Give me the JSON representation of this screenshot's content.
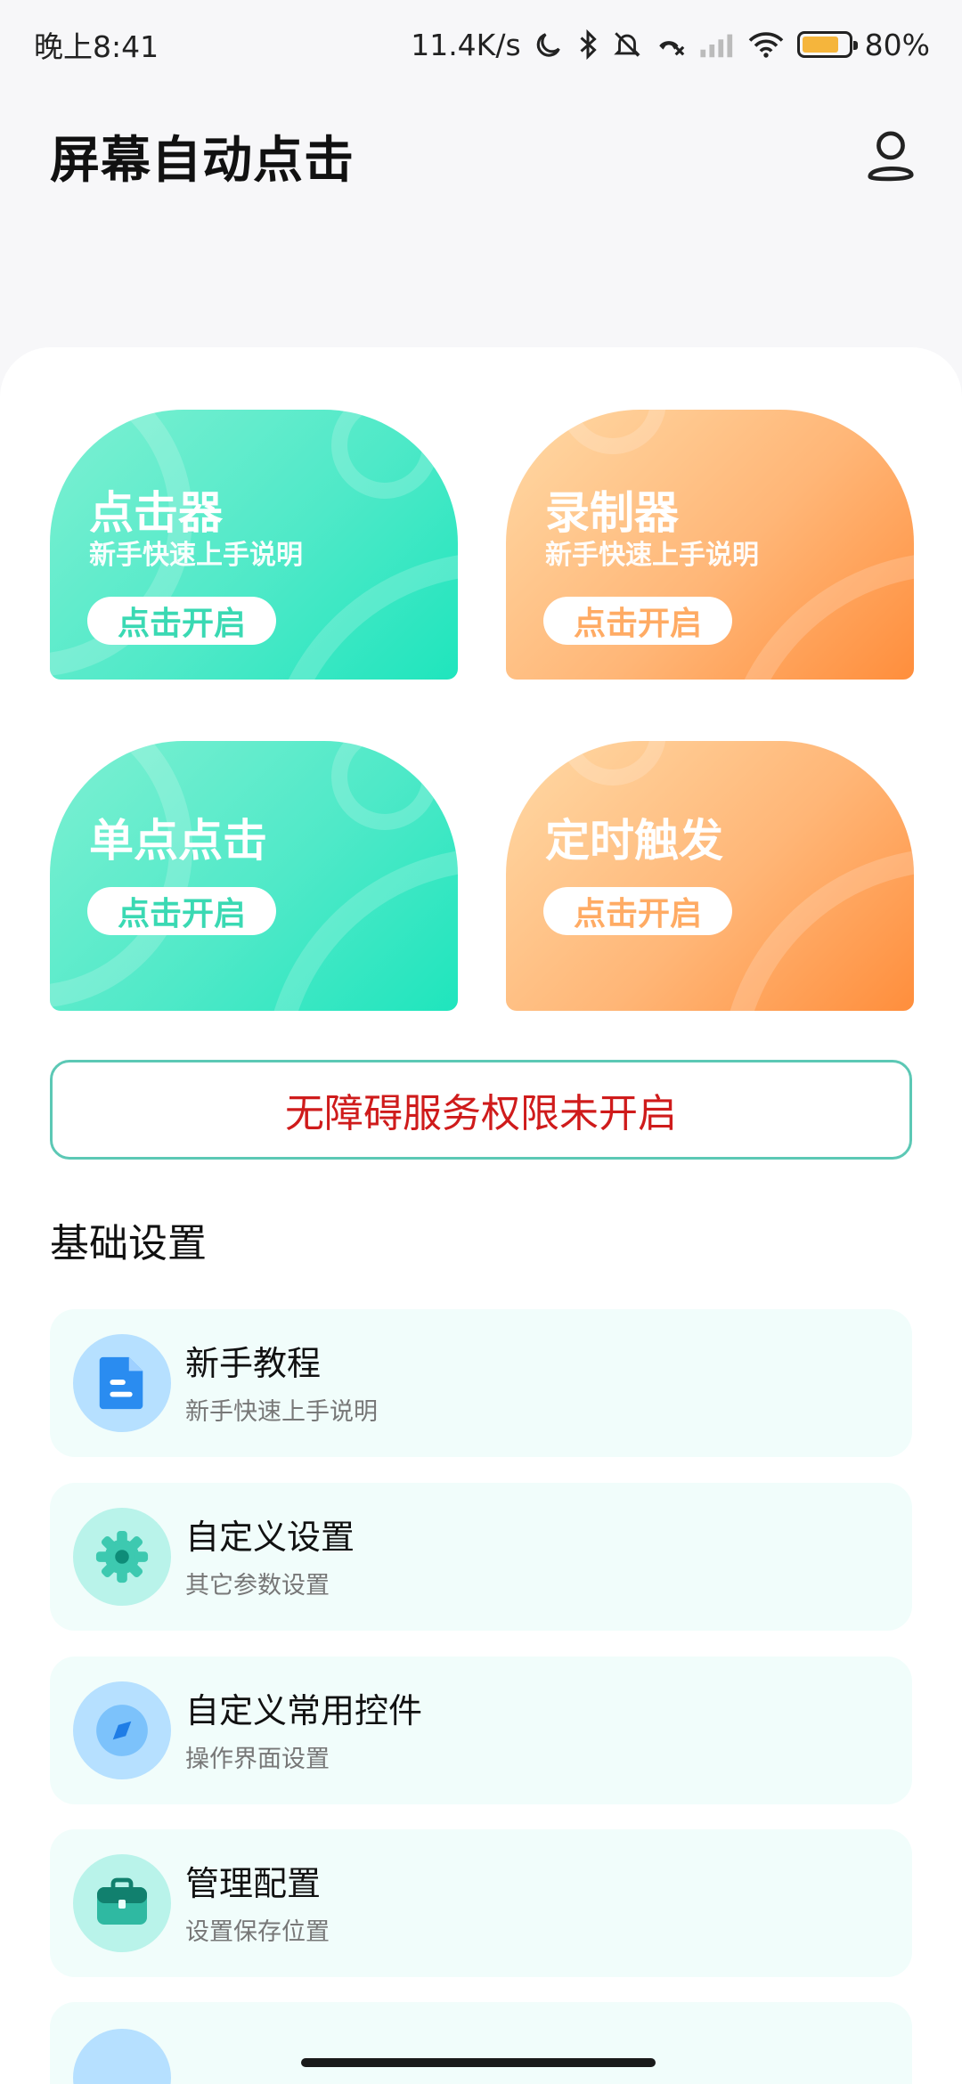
{
  "status_bar": {
    "time": "晚上8:41",
    "net_speed": "11.4K/s",
    "battery_percent": "80%",
    "battery_level": 0.8,
    "icons": [
      "moon-icon",
      "bluetooth-icon",
      "mute-bell-icon",
      "call-off-icon",
      "signal-icon",
      "wifi-icon",
      "battery-icon"
    ]
  },
  "header": {
    "title": "屏幕自动点击",
    "profile_icon": "user-icon"
  },
  "feature_cards": [
    {
      "title": "点击器",
      "subtitle": "新手快速上手说明",
      "button": "点击开启",
      "color": "#4fe9c8"
    },
    {
      "title": "录制器",
      "subtitle": "新手快速上手说明",
      "button": "点击开启",
      "color": "#ffb677"
    },
    {
      "title": "单点点击",
      "button": "点击开启",
      "color": "#4fe9c8"
    },
    {
      "title": "定时触发",
      "button": "点击开启",
      "color": "#ffb677"
    }
  ],
  "permission_banner": {
    "text": "无障碍服务权限未开启",
    "color": "#cf1b1b"
  },
  "basic_settings": {
    "title": "基础设置",
    "items": [
      {
        "title": "新手教程",
        "subtitle": "新手快速上手说明",
        "icon": "document-icon"
      },
      {
        "title": "自定义设置",
        "subtitle": "其它参数设置",
        "icon": "gear-icon"
      },
      {
        "title": "自定义常用控件",
        "subtitle": "操作界面设置",
        "icon": "compass-icon"
      },
      {
        "title": "管理配置",
        "subtitle": "设置保存位置",
        "icon": "briefcase-icon"
      }
    ]
  }
}
